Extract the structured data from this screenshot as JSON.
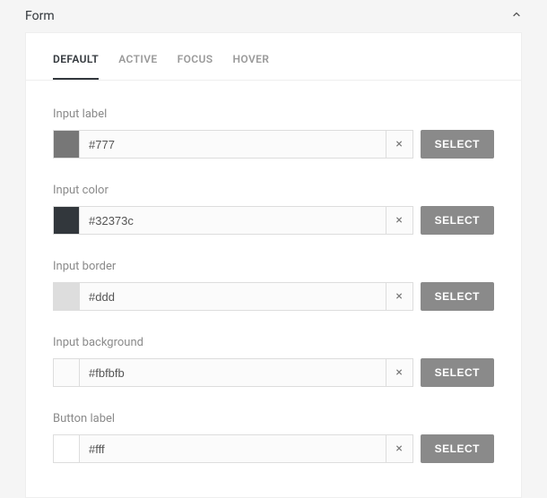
{
  "panel": {
    "title": "Form",
    "collapse_icon": "chevron-up"
  },
  "tabs": [
    {
      "label": "DEFAULT",
      "active": true
    },
    {
      "label": "ACTIVE",
      "active": false
    },
    {
      "label": "FOCUS",
      "active": false
    },
    {
      "label": "HOVER",
      "active": false
    }
  ],
  "fields": [
    {
      "label": "Input label",
      "value": "#777",
      "swatch": "#777777"
    },
    {
      "label": "Input color",
      "value": "#32373c",
      "swatch": "#32373c"
    },
    {
      "label": "Input border",
      "value": "#ddd",
      "swatch": "#dddddd"
    },
    {
      "label": "Input background",
      "value": "#fbfbfb",
      "swatch": "#fbfbfb"
    },
    {
      "label": "Button label",
      "value": "#fff",
      "swatch": "#ffffff"
    }
  ],
  "buttons": {
    "select": "SELECT",
    "clear": "×"
  }
}
